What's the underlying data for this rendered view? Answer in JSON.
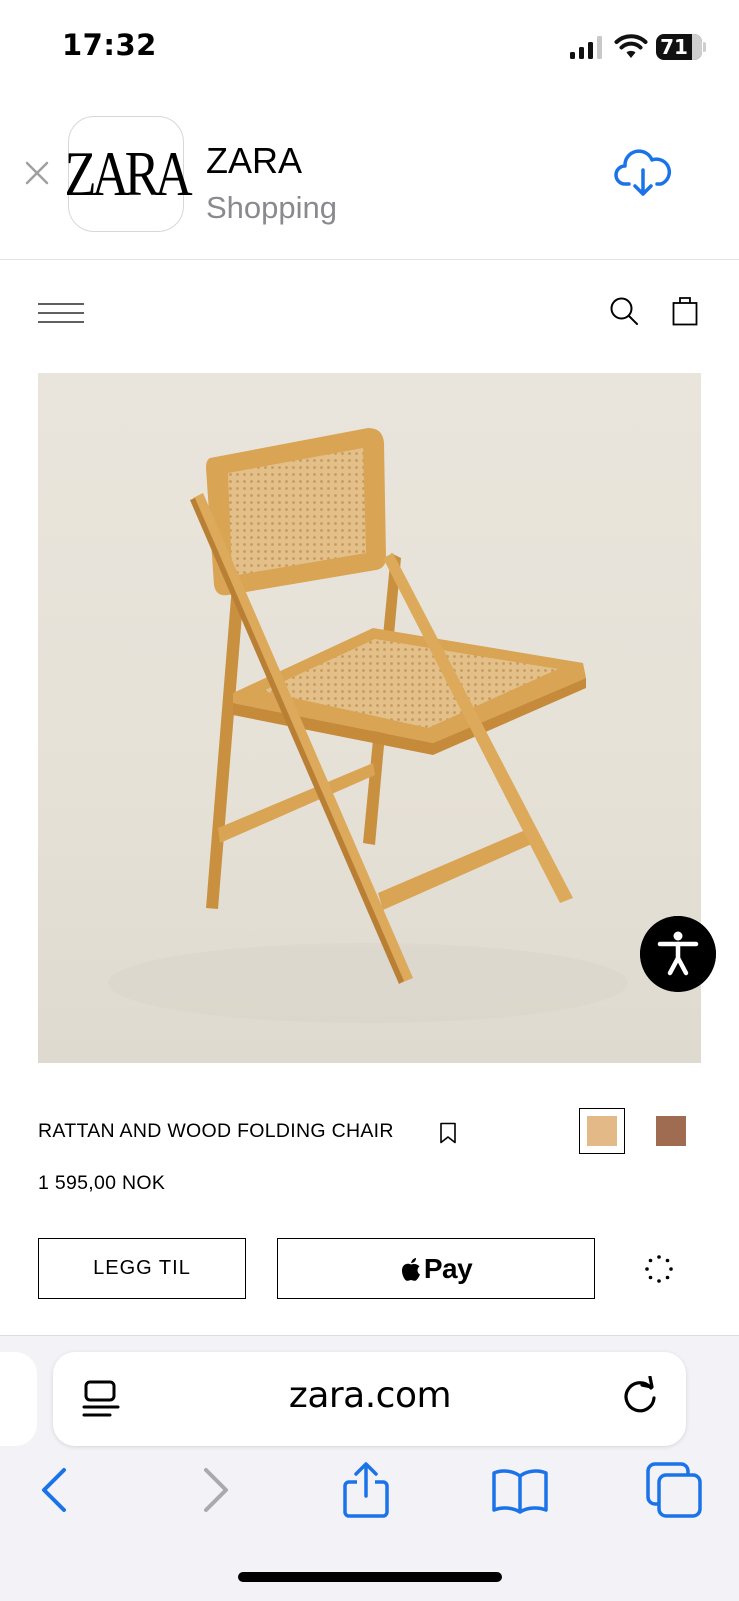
{
  "status_bar": {
    "time": "17:32",
    "battery": "71"
  },
  "app_banner": {
    "icon_text": "ZARA",
    "name": "ZARA",
    "category": "Shopping"
  },
  "site_header": {
    "icons": [
      "menu-icon",
      "search-icon",
      "shopping-bag-icon"
    ]
  },
  "product": {
    "name": "RATTAN AND WOOD FOLDING CHAIR",
    "price": "1 595,00 NOK",
    "colors": [
      "#e2b987",
      "#a06c51"
    ],
    "selected_color_index": 0,
    "add_button_label": "LEGG TIL",
    "pay_label": "Pay"
  },
  "safari": {
    "address": "zara.com",
    "accent": "#1a73e8"
  }
}
